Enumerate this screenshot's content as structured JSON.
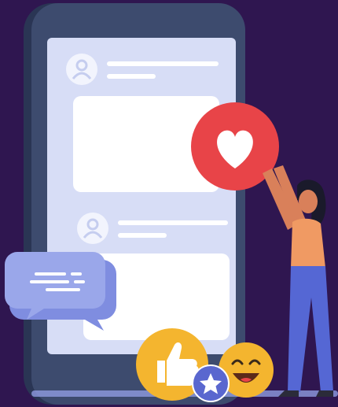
{
  "scene": {
    "description_free": true,
    "colors": {
      "background": "#2f1650",
      "phone_body": "#3d4b6e",
      "phone_edge": "#2a3554",
      "screen": "#d7ddf6",
      "card": "#ffffff",
      "avatar": "#f2f4fd",
      "avatar_figure": "#c5cdef",
      "text_line": "#ffffff",
      "heart_badge": "#e84448",
      "heart": "#ffffff",
      "chat_bubble": "#9aa7ea",
      "chat_bubble_back": "#7f8de0",
      "chat_lines": "#ffffff",
      "thumbs_badge": "#f4b52f",
      "star_badge": "#5a67cf",
      "smile_badge": "#f4b52f",
      "woman_hair": "#1a1a2b",
      "woman_skin": "#d9805a",
      "woman_top": "#f09a63",
      "woman_pants": "#5567d4",
      "woman_shoes": "#2b2b3a",
      "floor": "#8f9be0"
    },
    "icons": [
      "heart-icon",
      "thumbs-up-icon",
      "star-icon",
      "smile-emoji-icon",
      "chat-bubble-icon",
      "user-avatar-icon"
    ],
    "posts": [
      {
        "id": "post-1"
      },
      {
        "id": "post-2"
      }
    ]
  }
}
